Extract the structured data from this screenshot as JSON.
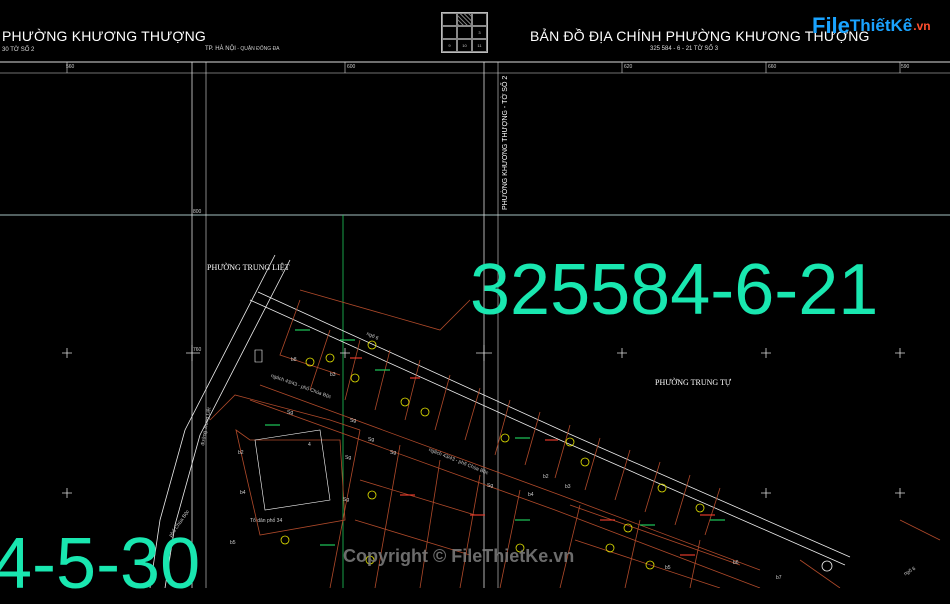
{
  "header": {
    "left_title": "PHƯỜNG KHƯƠNG THƯỢNG",
    "left_sub": "30 TỜ SỐ 2",
    "city": "TP. HÀ NỘI",
    "district": " - QUẬN ĐỐNG ĐA",
    "right_title": "BẢN ĐỒ ĐỊA CHÍNH PHƯỜNG KHƯƠNG THƯỢNG",
    "right_sub": "325 584 - 6 - 21 TỜ SỐ 3"
  },
  "index_grid": [
    "",
    "",
    "",
    "",
    "",
    "3",
    "9",
    "10",
    "11"
  ],
  "grid_labels": {
    "top": [
      "560",
      "600",
      "620",
      "660",
      "590"
    ],
    "left": [
      "800",
      "760"
    ]
  },
  "map": {
    "sheet_code_right": "325584-6-21",
    "sheet_code_left": "4-5-30",
    "ward_trung_liet": "PHƯỜNG TRUNG LIỆT",
    "ward_trung_tu": "PHƯỜNG TRUNG TỰ",
    "vertical_label": "PHƯỜNG KHƯƠNG THƯỢNG - TỜ SỐ 2",
    "alley_1": "ngách 43/43 - phố Chùa Bộc",
    "alley_2": "ngách 43/43 - phố Chùa Bộc",
    "lane_6": "ngõ 6",
    "lane_6b": "ngõ 6",
    "residential_group": "Tổ dân phố 34",
    "road_trung_liet": "đường Trung Liệt",
    "road_chua_boc": "phố Chùa Bộc",
    "parcel_labels": [
      "b8",
      "b2",
      "b3",
      "b4",
      "b5",
      "Sg",
      "Sg",
      "Sg",
      "Sg",
      "Sg",
      "Sg",
      "Sg",
      "b2",
      "b3",
      "b4",
      "4",
      "b5",
      "b6",
      "b7"
    ]
  },
  "logo": {
    "file": "File",
    "thiet": "ThiếtKế",
    "vn": ".vn"
  },
  "watermark": "Copyright © FileThietKe.vn",
  "colors": {
    "sheet_code": "#19e7b0",
    "grid_line": "#ffffff",
    "boundary_line": "#b04a2a",
    "green_line": "#1fc95a",
    "symbol_yellow": "#e6e600"
  }
}
